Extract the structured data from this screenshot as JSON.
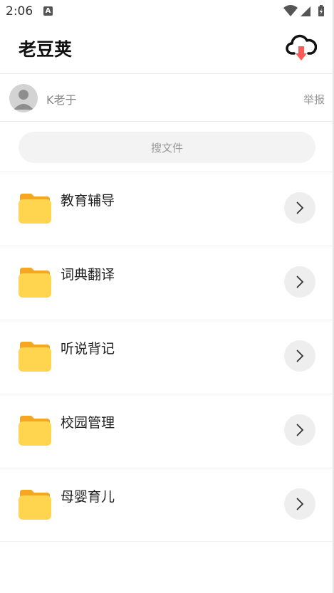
{
  "status_bar": {
    "time": "2:06",
    "notification_icon": "A"
  },
  "header": {
    "title": "老豆荚",
    "download_icon": "cloud-download-icon"
  },
  "author": {
    "name": "K老于",
    "report_label": "举报"
  },
  "search": {
    "placeholder": "搜文件"
  },
  "folders": [
    {
      "label": "教育辅导"
    },
    {
      "label": "词典翻译"
    },
    {
      "label": "听说背记"
    },
    {
      "label": "校园管理"
    },
    {
      "label": "母婴育儿"
    }
  ],
  "colors": {
    "folder": "#FFD54F",
    "folder_tab": "#F5A623",
    "download_arrow": "#FF5A5A"
  }
}
